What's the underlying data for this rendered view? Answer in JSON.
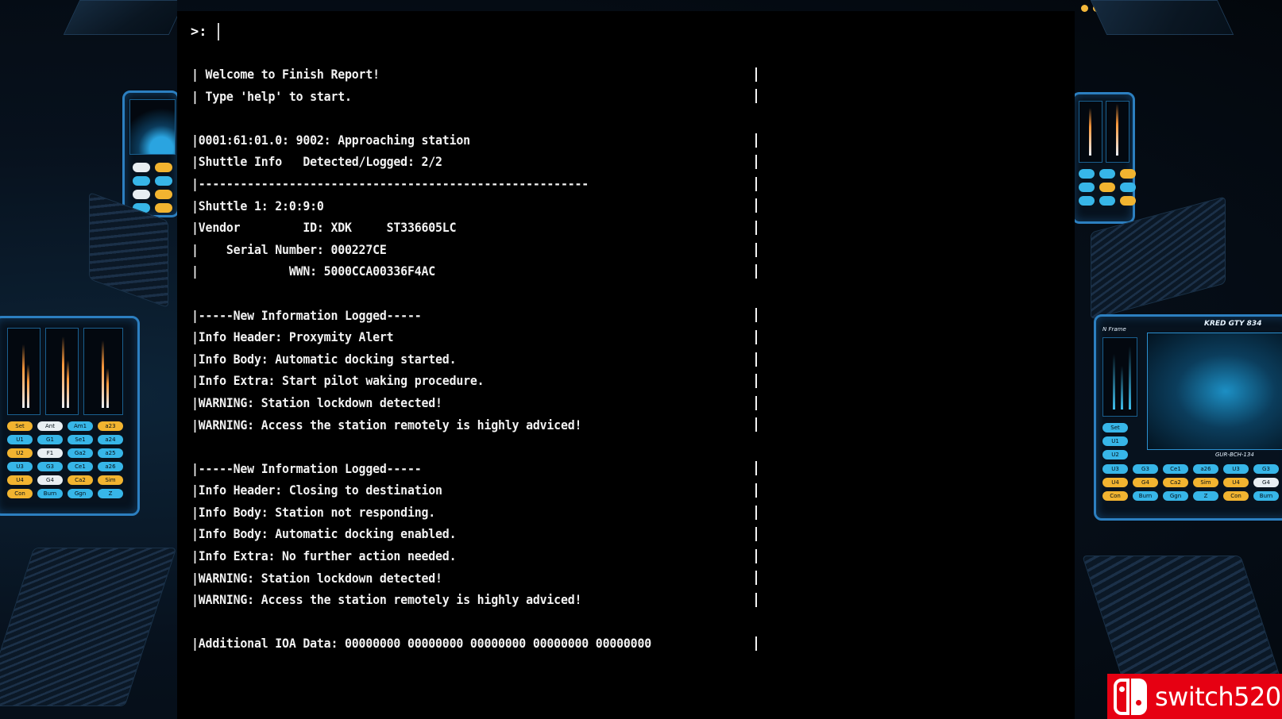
{
  "terminal": {
    "prompt": ">:",
    "lines": [
      {
        "text": "| Welcome to Finish Report!",
        "edge": true
      },
      {
        "text": "| Type 'help' to start.",
        "edge": true
      },
      {
        "text": "",
        "edge": false
      },
      {
        "text": "|0001:61:01.0: 9002: Approaching station",
        "edge": true
      },
      {
        "text": "|Shuttle Info   Detected/Logged: 2/2",
        "edge": true
      },
      {
        "text": "|--------------------------------------------------------",
        "edge": true
      },
      {
        "text": "|Shuttle 1: 2:0:9:0",
        "edge": true
      },
      {
        "text": "|Vendor         ID: XDK     ST336605LC",
        "edge": true
      },
      {
        "text": "|    Serial Number: 000227CE",
        "edge": true
      },
      {
        "text": "|             WWN: 5000CCA00336F4AC",
        "edge": true
      },
      {
        "text": "",
        "edge": false
      },
      {
        "text": "|-----New Information Logged-----",
        "edge": true
      },
      {
        "text": "|Info Header: Proxymity Alert",
        "edge": true
      },
      {
        "text": "|Info Body: Automatic docking started.",
        "edge": true
      },
      {
        "text": "|Info Extra: Start pilot waking procedure.",
        "edge": true
      },
      {
        "text": "|WARNING: Station lockdown detected!",
        "edge": true
      },
      {
        "text": "|WARNING: Access the station remotely is highly adviced!",
        "edge": true
      },
      {
        "text": "",
        "edge": false
      },
      {
        "text": "|-----New Information Logged-----",
        "edge": true
      },
      {
        "text": "|Info Header: Closing to destination",
        "edge": true
      },
      {
        "text": "|Info Body: Station not responding.",
        "edge": true
      },
      {
        "text": "|Info Body: Automatic docking enabled.",
        "edge": true
      },
      {
        "text": "|Info Extra: No further action needed.",
        "edge": true
      },
      {
        "text": "|WARNING: Station lockdown detected!",
        "edge": true
      },
      {
        "text": "|WARNING: Access the station remotely is highly adviced!",
        "edge": true
      },
      {
        "text": "",
        "edge": false
      },
      {
        "text": "|Additional IOA Data: 00000000 00000000 00000000 00000000 00000000",
        "edge": true
      }
    ]
  },
  "cockpit": {
    "left_buttons": [
      "Set",
      "Ant",
      "Am1",
      "a23",
      "U1",
      "G1",
      "Se1",
      "a24",
      "U2",
      "F1",
      "Ga2",
      "a25",
      "U3",
      "G3",
      "Ce1",
      "a26",
      "U4",
      "G4",
      "Ca2",
      "Sim",
      "Con",
      "Burn",
      "Ggn",
      "Z"
    ],
    "left_button_colors": [
      "o",
      "w",
      "b",
      "o",
      "b",
      "b",
      "b",
      "b",
      "o",
      "w",
      "b",
      "b",
      "b",
      "b",
      "b",
      "b",
      "o",
      "w",
      "o",
      "o",
      "o",
      "b",
      "b",
      "b"
    ],
    "right_title": "KRED GTY 834",
    "right_small_label": "N Frame",
    "right_sub_label": "GUR-BCH-134",
    "right_buttons": [
      "U3",
      "G3",
      "Ce1",
      "a26",
      "U3",
      "G3",
      "U4",
      "G4",
      "Ca2",
      "Sim",
      "U4",
      "G4",
      "Con",
      "Burn",
      "Ggn",
      "Z",
      "Con",
      "Burn"
    ],
    "right_button_colors": [
      "b",
      "b",
      "b",
      "b",
      "b",
      "b",
      "o",
      "o",
      "o",
      "o",
      "o",
      "w",
      "o",
      "b",
      "b",
      "b",
      "o",
      "b"
    ],
    "right_side_buttons": [
      "Set",
      "U1",
      "U2"
    ]
  },
  "watermark": {
    "text": "switch520"
  }
}
